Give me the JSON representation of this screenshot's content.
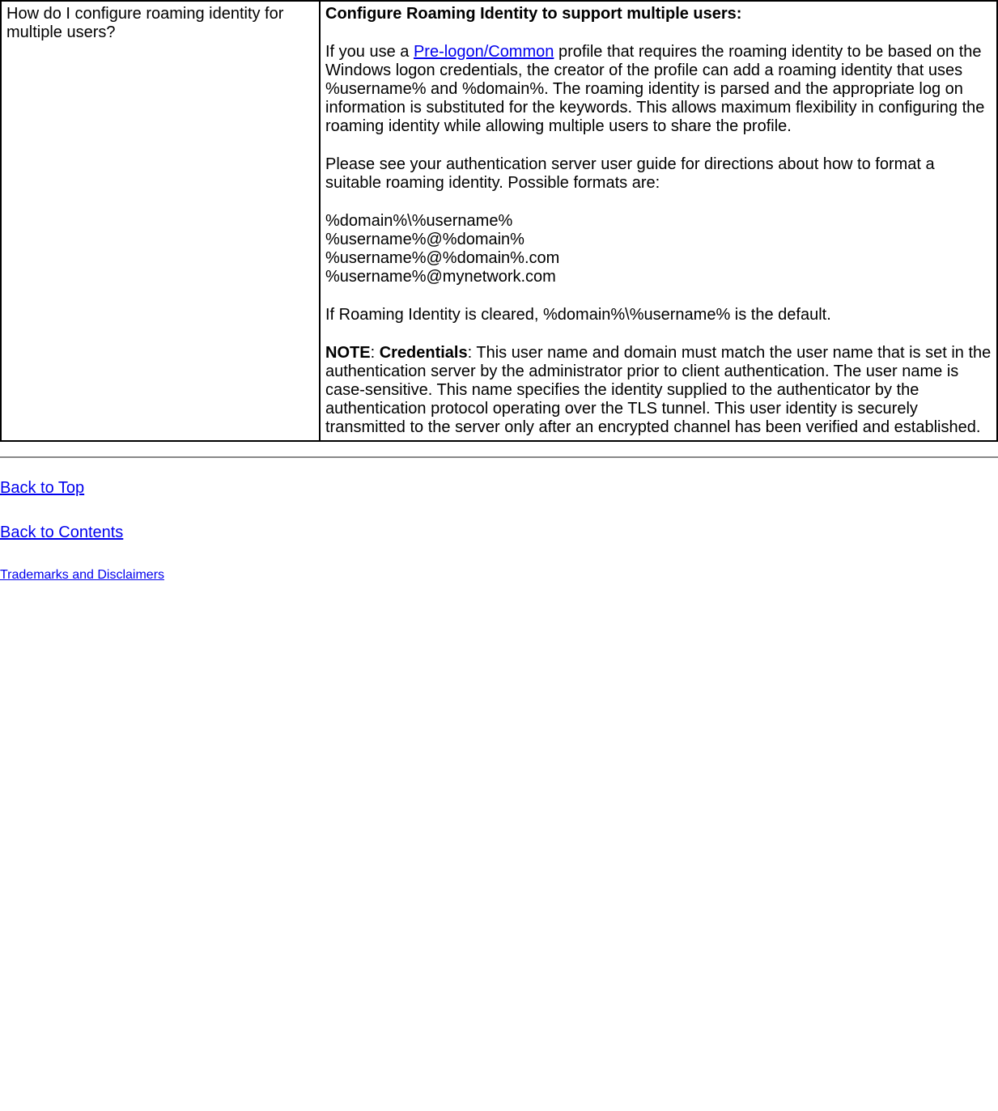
{
  "table": {
    "question": "How do I configure roaming identity for multiple users?",
    "answer": {
      "heading": "Configure Roaming Identity to support multiple users:",
      "p1_before": "If you use a ",
      "p1_link": "Pre-logon/Common",
      "p1_after": " profile that requires the roaming identity to be based on the Windows logon credentials, the creator of the profile can add a roaming identity that uses %username% and %domain%. The roaming identity is parsed and the appropriate log on information is substituted for the keywords. This allows maximum flexibility in configuring the roaming identity while allowing multiple users to share the profile.",
      "p2": "Please see your authentication server user guide for directions about how to format a suitable roaming identity. Possible formats are:",
      "formats": {
        "f1": "%domain%\\%username%",
        "f2": "%username%@%domain%",
        "f3": "%username%@%domain%.com",
        "f4": "%username%@mynetwork.com"
      },
      "p3": "If Roaming Identity is cleared, %domain%\\%username% is the default.",
      "note_label": "NOTE",
      "note_sublabel": "Credentials",
      "note_text": ": This user name and domain must match the user name that is set in the authentication server by the administrator prior to client authentication. The user name is case-sensitive. This name specifies the identity supplied to the authenticator by the authentication protocol operating over the TLS tunnel. This user identity is securely transmitted to the server only after an encrypted channel has been verified and established."
    }
  },
  "links": {
    "back_to_top": "Back to Top",
    "back_to_contents": "Back to Contents",
    "trademarks": "Trademarks and Disclaimers"
  }
}
